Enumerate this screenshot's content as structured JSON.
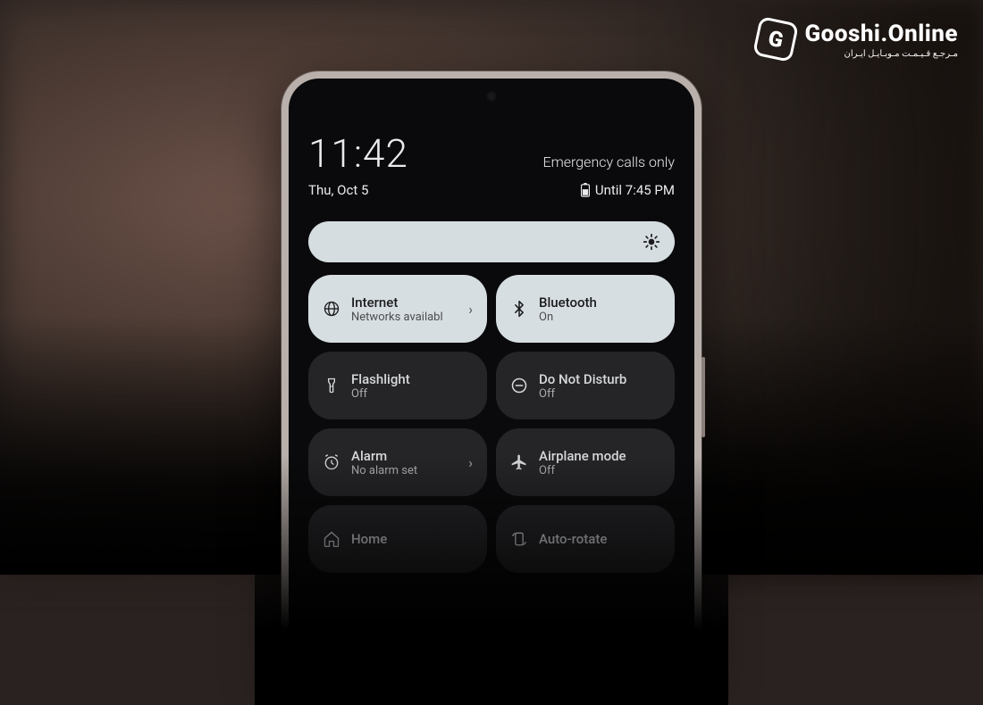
{
  "watermark": {
    "icon_letter": "G",
    "title": "Gooshi.Online",
    "subtitle": "مـرجـع قـیـمـت مـوبـایـل ایـران"
  },
  "status": {
    "time": "11:42",
    "emergency": "Emergency calls only",
    "date": "Thu, Oct 5",
    "battery_until": "Until 7:45 PM"
  },
  "tiles": [
    {
      "key": "internet",
      "title": "Internet",
      "sub": "Networks availabl",
      "active": true,
      "chevron": true,
      "icon": "globe"
    },
    {
      "key": "bluetooth",
      "title": "Bluetooth",
      "sub": "On",
      "active": true,
      "chevron": false,
      "icon": "bluetooth"
    },
    {
      "key": "flashlight",
      "title": "Flashlight",
      "sub": "Off",
      "active": false,
      "chevron": false,
      "icon": "flashlight"
    },
    {
      "key": "dnd",
      "title": "Do Not Disturb",
      "sub": "Off",
      "active": false,
      "chevron": false,
      "icon": "dnd"
    },
    {
      "key": "alarm",
      "title": "Alarm",
      "sub": "No alarm set",
      "active": false,
      "chevron": true,
      "icon": "alarm"
    },
    {
      "key": "airplane",
      "title": "Airplane mode",
      "sub": "Off",
      "active": false,
      "chevron": false,
      "icon": "airplane"
    },
    {
      "key": "home",
      "title": "Home",
      "sub": "",
      "active": false,
      "chevron": false,
      "icon": "home"
    },
    {
      "key": "autorotate",
      "title": "Auto-rotate",
      "sub": "",
      "active": false,
      "chevron": false,
      "icon": "rotate"
    }
  ]
}
